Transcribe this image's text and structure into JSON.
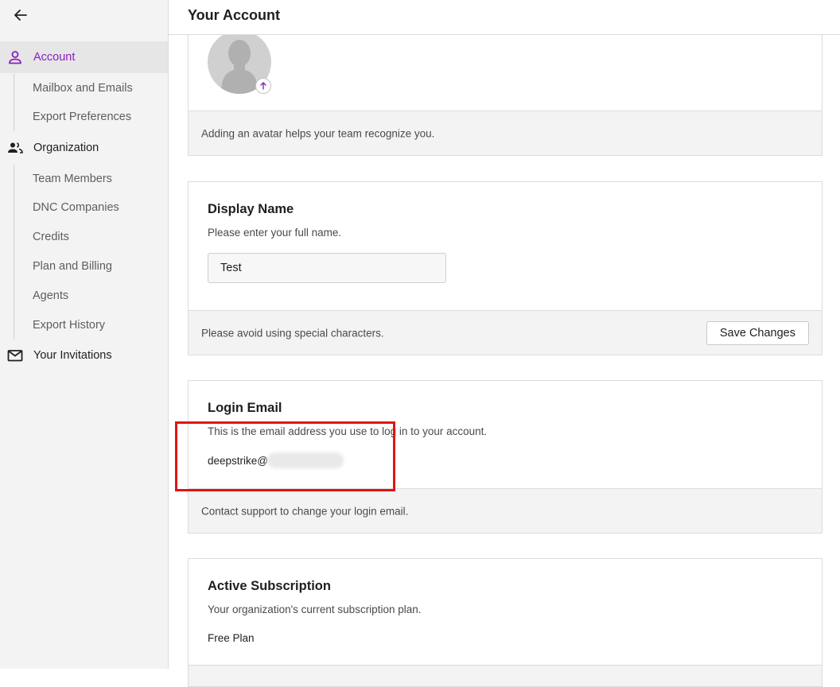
{
  "page": {
    "title": "Your Account"
  },
  "sidebar": {
    "items": [
      {
        "label": "Account",
        "icon": "person-icon",
        "active": true
      },
      {
        "label": "Mailbox and Emails"
      },
      {
        "label": "Export Preferences"
      },
      {
        "label": "Organization",
        "icon": "people-icon"
      },
      {
        "label": "Team Members"
      },
      {
        "label": "DNC Companies"
      },
      {
        "label": "Credits"
      },
      {
        "label": "Plan and Billing"
      },
      {
        "label": "Agents"
      },
      {
        "label": "Export History"
      },
      {
        "label": "Your Invitations",
        "icon": "mail-icon"
      }
    ]
  },
  "avatar_card": {
    "footer": "Adding an avatar helps your team recognize you."
  },
  "display_name": {
    "heading": "Display Name",
    "subtitle": "Please enter your full name.",
    "value": "Test",
    "footer": "Please avoid using special characters.",
    "save_label": "Save Changes"
  },
  "login_email": {
    "heading": "Login Email",
    "subtitle": "This is the email address you use to log in to your account.",
    "email_visible": "deepstrike@",
    "footer": "Contact support to change your login email."
  },
  "subscription": {
    "heading": "Active Subscription",
    "subtitle": "Your organization's current subscription plan.",
    "plan": "Free Plan"
  },
  "colors": {
    "accent": "#8a1fc0",
    "highlight": "#e01414",
    "sidebar_bg": "#f3f3f3"
  }
}
